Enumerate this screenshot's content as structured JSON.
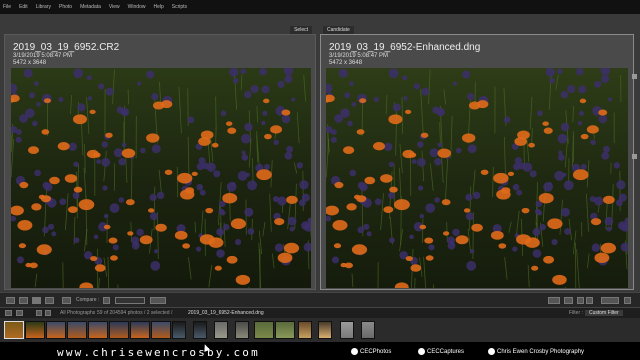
{
  "menu": [
    "File",
    "Edit",
    "Library",
    "Photo",
    "Metadata",
    "View",
    "Window",
    "Help",
    "Scripts"
  ],
  "panes": {
    "select": {
      "tag": "Select",
      "filename": "2019_03_19_6952.CR2",
      "datetime": "3/19/2019 5:08:47 PM",
      "dimensions": "5472 x 3648"
    },
    "candidate": {
      "tag": "Candidate",
      "filename": "2019_03_19_6952-Enhanced.dng",
      "datetime": "3/19/2019 5:08:47 PM",
      "dimensions": "5472 x 3648"
    }
  },
  "toolbar": {
    "compare_label": "Compare :"
  },
  "filmstrip_bar": {
    "source": "All Photographs",
    "count": "59 of 204594 photos / 2 selected /",
    "current_file": "2019_03_19_6952-Enhanced.dng",
    "filter_label": "Filter :",
    "filter_value": "Custom Filter"
  },
  "footer": {
    "url": "www.chrisewencrosby.com",
    "social1": "CECPhotos",
    "social2": "CECCaptures",
    "social3": "Chris Ewen Crosby Photography"
  },
  "colors": {
    "orange": "#e06a1a",
    "purple": "#3c2f6a",
    "dark_green": "#1e2a10"
  }
}
